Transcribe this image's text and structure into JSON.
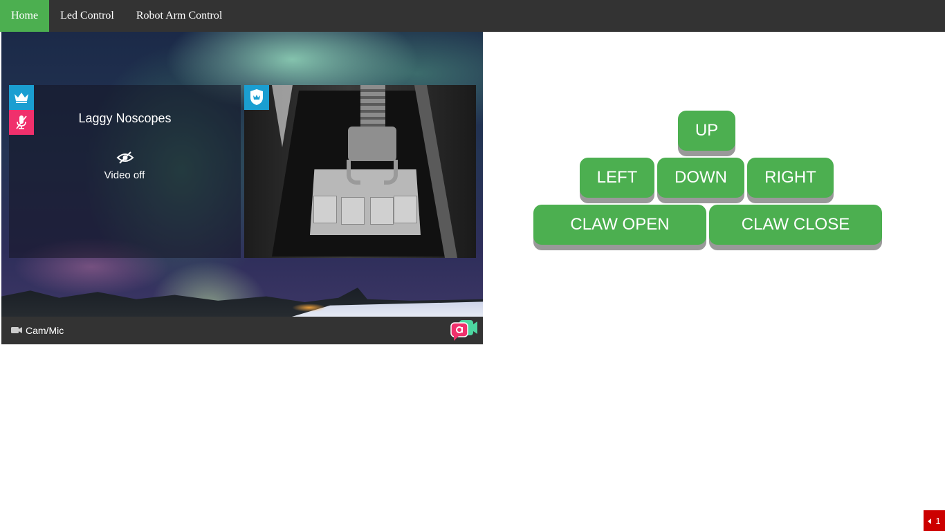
{
  "nav": {
    "items": [
      {
        "label": "Home",
        "active": true
      },
      {
        "label": "Led Control",
        "active": false
      },
      {
        "label": "Robot Arm Control",
        "active": false
      }
    ],
    "active_color": "#4caf50",
    "bar_color": "#333333"
  },
  "video_chat": {
    "local_tile": {
      "user_name": "Laggy Noscopes",
      "video_status": "Video off",
      "icons": [
        "crown-icon",
        "mic-muted-icon",
        "eye-off-icon"
      ]
    },
    "remote_tile": {
      "icons": [
        "shield-icon"
      ]
    },
    "footer": {
      "cam_mic_label": "Cam/Mic",
      "icons": [
        "video-camera-icon",
        "chat-app-logo"
      ]
    }
  },
  "robot_controls": {
    "up": "UP",
    "left": "LEFT",
    "down": "DOWN",
    "right": "RIGHT",
    "claw_open": "CLAW OPEN",
    "claw_close": "CLAW CLOSE",
    "button_color": "#4caf50"
  },
  "corner_badge": {
    "count": "1",
    "color": "#cc0000"
  }
}
